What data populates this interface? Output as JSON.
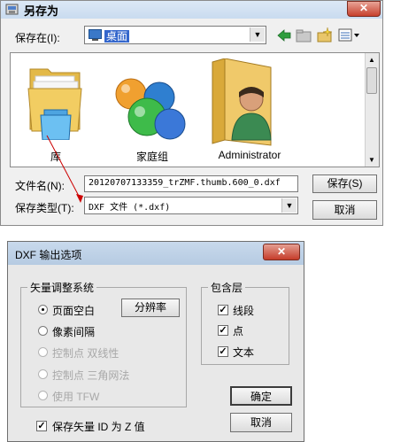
{
  "save_dialog": {
    "title": "另存为",
    "close_glyph": "✕",
    "save_in_label": "保存在(I):",
    "save_in_value": "桌面",
    "items": [
      {
        "label": "库",
        "icon": "library-folder-icon"
      },
      {
        "label": "家庭组",
        "icon": "homegroup-icon"
      },
      {
        "label": "Administrator",
        "icon": "user-folder-icon"
      }
    ],
    "filename_label": "文件名(N):",
    "filename_value": "20120707133359_trZMF.thumb.600_0.dxf",
    "filetype_label": "保存类型(T):",
    "filetype_value": "DXF 文件 (*.dxf)",
    "save_button": "保存(S)",
    "cancel_button": "取消",
    "annotation_color": "#cc0000"
  },
  "dxf_dialog": {
    "title": "DXF 输出选项",
    "close_glyph": "✕",
    "vector_group_title": "矢量调整系统",
    "options": [
      {
        "label": "页面空白",
        "selected": true,
        "enabled": true
      },
      {
        "label": "像素间隔",
        "selected": false,
        "enabled": true
      },
      {
        "label": "控制点 双线性",
        "selected": false,
        "enabled": false
      },
      {
        "label": "控制点 三角网法",
        "selected": false,
        "enabled": false
      },
      {
        "label": "使用 TFW",
        "selected": false,
        "enabled": false
      }
    ],
    "resolution_button": "分辨率",
    "layers_group_title": "包含层",
    "layers": [
      {
        "label": "线段",
        "checked": true
      },
      {
        "label": "点",
        "checked": true
      },
      {
        "label": "文本",
        "checked": true
      }
    ],
    "keep_id_label": "保存矢量 ID 为 Z 值",
    "keep_id_checked": true,
    "ok_button": "确定",
    "cancel_button": "取消"
  }
}
